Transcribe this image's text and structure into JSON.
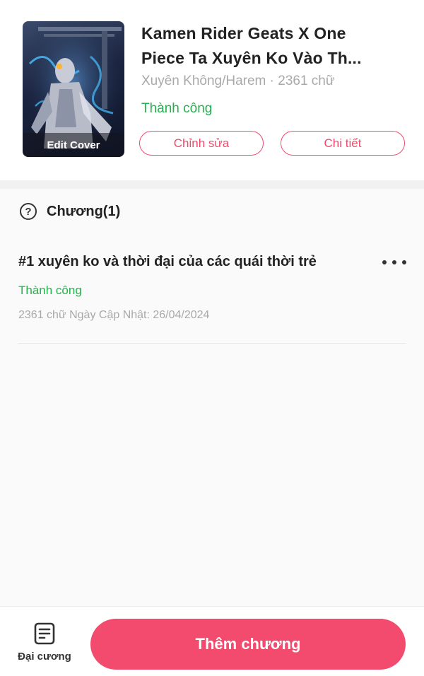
{
  "book": {
    "cover_overlay_label": "Edit Cover",
    "title_line1": "Kamen Rider Geats X One",
    "title_line2": "Piece Ta Xuyên Ko Vào Th...",
    "meta": "Xuyên Không/Harem · 2361 chữ",
    "status": "Thành công",
    "edit_button": "Chỉnh sửa",
    "detail_button": "Chi tiết"
  },
  "chapters_section": {
    "icon": "help-circle-icon",
    "header_label": "Chương(1)",
    "items": [
      {
        "title": "#1 xuyên ko và thời đại của các quái thời trẻ",
        "status": "Thành công",
        "meta": "2361 chữ Ngày Cập Nhật: 26/04/2024",
        "menu_icon": "more-horizontal-icon"
      }
    ]
  },
  "bottom_bar": {
    "outline_icon": "document-list-icon",
    "outline_label": "Đại cương",
    "add_chapter_label": "Thêm chương"
  },
  "colors": {
    "accent": "#f24b6e",
    "success": "#22b14c",
    "muted": "#a9a9a9"
  }
}
